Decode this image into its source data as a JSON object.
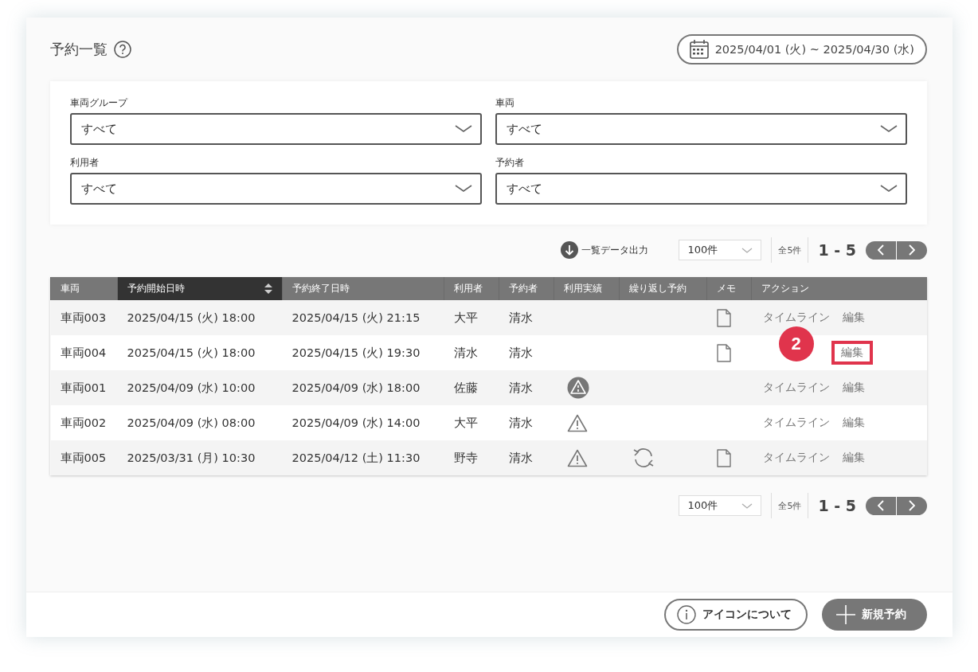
{
  "header": {
    "title": "予約一覧",
    "date_range": "2025/04/01 (火) ~ 2025/04/30 (水)"
  },
  "filters": [
    {
      "label": "車両グループ",
      "value": "すべて"
    },
    {
      "label": "車両",
      "value": "すべて"
    },
    {
      "label": "利用者",
      "value": "すべて"
    },
    {
      "label": "予約者",
      "value": "すべて"
    }
  ],
  "export_label": "一覧データ出力",
  "pager_top": {
    "page_size": "100件",
    "total": "全5件",
    "range": "1 - 5"
  },
  "table": {
    "columns": [
      {
        "label": "車両",
        "selected": false
      },
      {
        "label": "予約開始日時",
        "selected": true
      },
      {
        "label": "予約終了日時",
        "selected": false
      },
      {
        "label": "利用者",
        "selected": false
      },
      {
        "label": "予約者",
        "selected": false
      },
      {
        "label": "利用実績",
        "selected": false
      },
      {
        "label": "繰り返し予約",
        "selected": false
      },
      {
        "label": "メモ",
        "selected": false
      },
      {
        "label": "アクション",
        "selected": false
      }
    ],
    "rows": [
      {
        "vehicle": "車両003",
        "start": "2025/04/15 (火) 18:00",
        "end": "2025/04/15 (火) 21:15",
        "user": "大平",
        "booker": "清水",
        "repeat": false,
        "memo": true,
        "actions": [
          {
            "kind": "timeline",
            "label": "タイムライン"
          },
          {
            "kind": "edit",
            "label": "編集",
            "highlighted": false
          }
        ]
      },
      {
        "vehicle": "車両004",
        "start": "2025/04/15 (火) 18:00",
        "end": "2025/04/15 (火) 19:30",
        "user": "清水",
        "booker": "清水",
        "repeat": false,
        "memo": true,
        "callout": "2",
        "actions": [
          {
            "kind": "edit",
            "label": "編集",
            "highlighted": true
          }
        ]
      },
      {
        "vehicle": "車両001",
        "start": "2025/04/09 (水) 10:00",
        "end": "2025/04/09 (水) 18:00",
        "user": "佐藤",
        "booker": "清水",
        "usage": {
          "kind": "warning-filled"
        },
        "repeat": false,
        "memo": false,
        "actions": [
          {
            "kind": "timeline",
            "label": "タイムライン"
          },
          {
            "kind": "edit",
            "label": "編集",
            "highlighted": false
          }
        ]
      },
      {
        "vehicle": "車両002",
        "start": "2025/04/09 (水) 08:00",
        "end": "2025/04/09 (水) 14:00",
        "user": "大平",
        "booker": "清水",
        "usage": {
          "kind": "warning"
        },
        "repeat": false,
        "memo": false,
        "actions": [
          {
            "kind": "timeline",
            "label": "タイムライン"
          },
          {
            "kind": "edit",
            "label": "編集",
            "highlighted": false
          }
        ]
      },
      {
        "vehicle": "車両005",
        "start": "2025/03/31 (月) 10:30",
        "end": "2025/04/12 (土) 11:30",
        "user": "野寺",
        "booker": "清水",
        "usage": {
          "kind": "warning"
        },
        "repeat": true,
        "memo": true,
        "actions": [
          {
            "kind": "timeline",
            "label": "タイムライン"
          },
          {
            "kind": "edit",
            "label": "編集",
            "highlighted": false
          }
        ]
      }
    ]
  },
  "pager_bottom": {
    "page_size": "100件",
    "total": "全5件",
    "range": "1 - 5"
  },
  "footer": {
    "buttons": [
      {
        "kind": "info",
        "label": "アイコンについて"
      },
      {
        "kind": "add",
        "label": "新規予約"
      }
    ]
  }
}
